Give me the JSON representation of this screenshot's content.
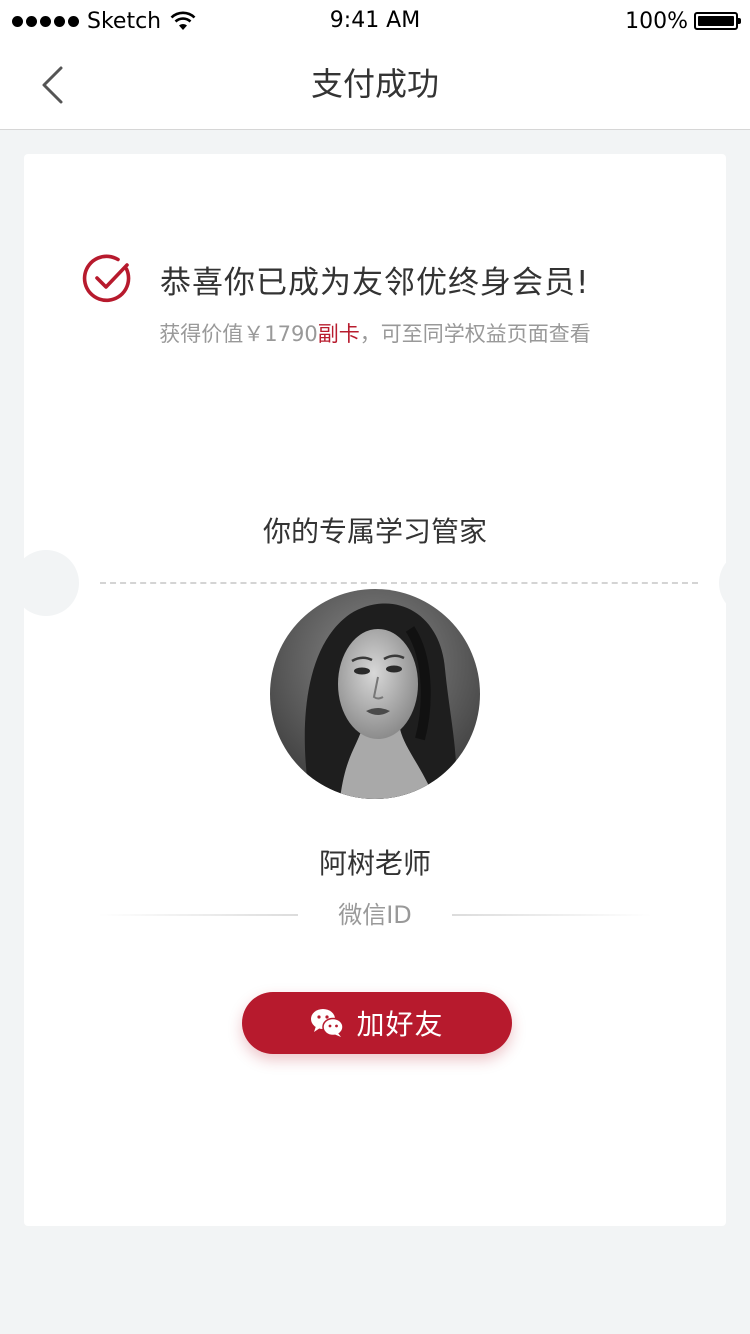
{
  "status_bar": {
    "carrier": "Sketch",
    "time": "9:41 AM",
    "battery_percent": "100%",
    "battery_level": 1.0,
    "wifi_icon": "wifi-icon",
    "signal_icon": "signal-dots-icon"
  },
  "nav": {
    "title": "支付成功",
    "back_icon": "chevron-left-icon"
  },
  "success": {
    "icon": "check-circle-icon",
    "title": "恭喜你已成为友邻优终身会员!",
    "subtitle_prefix": "获得价值￥1790",
    "subtitle_highlight": "副卡",
    "subtitle_suffix": "，可至同学权益页面查看"
  },
  "manager": {
    "heading": "你的专属学习管家",
    "name": "阿树老师",
    "wechat_id_label": "微信ID"
  },
  "action": {
    "button_label": "加好友",
    "button_icon": "wechat-icon"
  },
  "colors": {
    "accent": "#b71a2d",
    "background": "#f2f4f5",
    "card": "#ffffff",
    "text_primary": "#333333",
    "text_secondary": "#999999"
  }
}
